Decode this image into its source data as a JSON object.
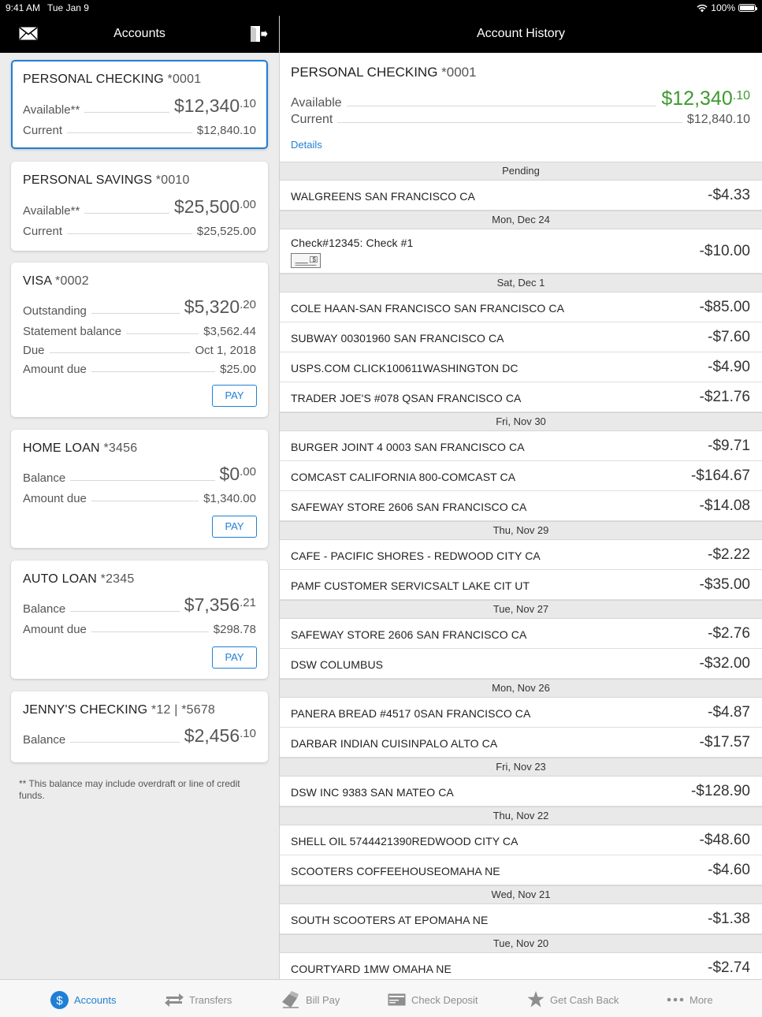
{
  "status_bar": {
    "time": "9:41 AM",
    "date": "Tue Jan 9",
    "battery": "100%"
  },
  "left_nav": {
    "title": "Accounts"
  },
  "right_nav": {
    "title": "Account History"
  },
  "accounts": [
    {
      "name": "PERSONAL CHECKING",
      "number": "*0001",
      "rows": [
        {
          "label": "Available**",
          "value": "$12,340",
          "cents": ".10",
          "big": true,
          "green": true
        },
        {
          "label": "Current",
          "value": "$12,840.10"
        }
      ]
    },
    {
      "name": "PERSONAL SAVINGS",
      "number": "*0010",
      "rows": [
        {
          "label": "Available**",
          "value": "$25,500",
          "cents": ".00",
          "big": true,
          "green": true
        },
        {
          "label": "Current",
          "value": "$25,525.00"
        }
      ]
    },
    {
      "name": "VISA",
      "number": "*0002",
      "rows": [
        {
          "label": "Outstanding",
          "value": "$5,320",
          "cents": ".20",
          "big": true
        },
        {
          "label": "Statement balance",
          "value": "$3,562.44"
        },
        {
          "label": "Due",
          "value": "Oct 1, 2018"
        },
        {
          "label": "Amount due",
          "value": "$25.00"
        }
      ],
      "pay": "PAY"
    },
    {
      "name": "HOME LOAN",
      "number": "*3456",
      "rows": [
        {
          "label": "Balance",
          "value": "$0",
          "cents": ".00",
          "big": true
        },
        {
          "label": "Amount due",
          "value": "$1,340.00"
        }
      ],
      "pay": "PAY"
    },
    {
      "name": "AUTO LOAN",
      "number": "*2345",
      "rows": [
        {
          "label": "Balance",
          "value": "$7,356",
          "cents": ".21",
          "big": true
        },
        {
          "label": "Amount due",
          "value": "$298.78"
        }
      ],
      "pay": "PAY"
    },
    {
      "name": "JENNY'S CHECKING",
      "number": "*12 | *5678",
      "rows": [
        {
          "label": "Balance",
          "value": "$2,456",
          "cents": ".10",
          "big": true,
          "green": true
        }
      ]
    }
  ],
  "footnote": "** This balance may include overdraft or line of credit funds.",
  "detail": {
    "name": "PERSONAL CHECKING",
    "number": "*0001",
    "available_label": "Available",
    "available_value": "$12,340",
    "available_cents": ".10",
    "current_label": "Current",
    "current_value": "$12,840.10",
    "details_link": "Details"
  },
  "history": [
    {
      "section": "Pending",
      "items": [
        {
          "desc": "WALGREENS SAN FRANCISCO CA",
          "amount": "-$4.33"
        }
      ]
    },
    {
      "section": "Mon, Dec 24",
      "items": [
        {
          "desc": "Check#12345: Check #1",
          "amount": "-$10.00",
          "check": true
        }
      ]
    },
    {
      "section": "Sat, Dec 1",
      "items": [
        {
          "desc": "COLE HAAN-SAN FRANCISCO SAN FRANCISCO CA",
          "amount": "-$85.00"
        },
        {
          "desc": "SUBWAY 00301960 SAN FRANCISCO CA",
          "amount": "-$7.60"
        },
        {
          "desc": "USPS.COM CLICK100611WASHINGTON DC",
          "amount": "-$4.90"
        },
        {
          "desc": "TRADER JOE'S #078 QSAN FRANCISCO CA",
          "amount": "-$21.76"
        }
      ]
    },
    {
      "section": "Fri, Nov 30",
      "items": [
        {
          "desc": "BURGER JOINT 4 0003 SAN FRANCISCO CA",
          "amount": "-$9.71"
        },
        {
          "desc": "COMCAST CALIFORNIA 800-COMCAST CA",
          "amount": "-$164.67"
        },
        {
          "desc": "SAFEWAY STORE 2606 SAN FRANCISCO CA",
          "amount": "-$14.08"
        }
      ]
    },
    {
      "section": "Thu, Nov 29",
      "items": [
        {
          "desc": "CAFE - PACIFIC SHORES - REDWOOD CITY CA",
          "amount": "-$2.22"
        },
        {
          "desc": "PAMF CUSTOMER SERVICSALT LAKE CIT UT",
          "amount": "-$35.00"
        }
      ]
    },
    {
      "section": "Tue, Nov 27",
      "items": [
        {
          "desc": "SAFEWAY STORE 2606 SAN FRANCISCO CA",
          "amount": "-$2.76"
        },
        {
          "desc": "DSW COLUMBUS",
          "amount": "-$32.00"
        }
      ]
    },
    {
      "section": "Mon, Nov 26",
      "items": [
        {
          "desc": "PANERA BREAD #4517 0SAN FRANCISCO CA",
          "amount": "-$4.87"
        },
        {
          "desc": "DARBAR INDIAN CUISINPALO ALTO CA",
          "amount": "-$17.57"
        }
      ]
    },
    {
      "section": "Fri, Nov 23",
      "items": [
        {
          "desc": "DSW INC 9383 SAN MATEO CA",
          "amount": "-$128.90"
        }
      ]
    },
    {
      "section": "Thu, Nov 22",
      "items": [
        {
          "desc": "SHELL OIL 5744421390REDWOOD CITY CA",
          "amount": "-$48.60"
        },
        {
          "desc": "SCOOTERS COFFEEHOUSEOMAHA NE",
          "amount": "-$4.60"
        }
      ]
    },
    {
      "section": "Wed, Nov 21",
      "items": [
        {
          "desc": "SOUTH SCOOTERS AT EPOMAHA NE",
          "amount": "-$1.38"
        }
      ]
    },
    {
      "section": "Tue, Nov 20",
      "items": [
        {
          "desc": "COURTYARD 1MW OMAHA NE",
          "amount": "-$2.74"
        }
      ]
    }
  ],
  "tabs": [
    {
      "label": "Accounts",
      "icon": "dollar-circle-icon",
      "active": true
    },
    {
      "label": "Transfers",
      "icon": "transfer-arrows-icon"
    },
    {
      "label": "Bill Pay",
      "icon": "bill-pay-icon"
    },
    {
      "label": "Check Deposit",
      "icon": "check-deposit-icon"
    },
    {
      "label": "Get Cash Back",
      "icon": "star-icon"
    },
    {
      "label": "More",
      "icon": "more-dots-icon"
    }
  ],
  "colors": {
    "accent": "#1f7fd6",
    "positive": "#3e9a2f",
    "navbar": "#000000"
  }
}
